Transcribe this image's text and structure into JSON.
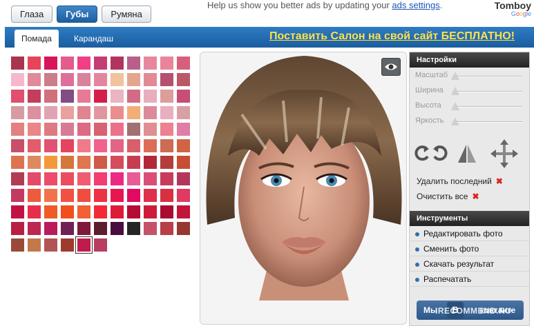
{
  "top_tabs": [
    {
      "label": "Глаза",
      "active": false
    },
    {
      "label": "Губы",
      "active": true
    },
    {
      "label": "Румяна",
      "active": false
    }
  ],
  "ads_note": {
    "text": "Help us show you better ads by updating your ",
    "link": "ads settings",
    "suffix": "."
  },
  "brand": {
    "name": "Tomboy",
    "sub_prefix": "Google"
  },
  "sub_tabs": [
    {
      "label": "Помада",
      "active": true
    },
    {
      "label": "Карандаш",
      "active": false
    }
  ],
  "promo_link": "Поставить Салон на свой сайт БЕСПЛАТНО!",
  "palette": {
    "columns": 11,
    "selected_index": 125,
    "colors": [
      "#a8354b",
      "#e9435a",
      "#d8155a",
      "#e35c8c",
      "#f03f86",
      "#c43c74",
      "#b23560",
      "#b8608a",
      "#e7879e",
      "#e9859a",
      "#d65f7e",
      "#f6b7cc",
      "#e18a9a",
      "#cc7d8a",
      "#dd6f9a",
      "#d9829c",
      "#e3869d",
      "#f0c39d",
      "#e3a58d",
      "#e28a93",
      "#b55070",
      "#ba5867",
      "#e24e6d",
      "#c23e5b",
      "#d0707d",
      "#834c83",
      "#e97a95",
      "#d3204a",
      "#e8b5c0",
      "#d26c84",
      "#e7aebd",
      "#dd9d9c",
      "#c64e77",
      "#d69ca2",
      "#dc8f9f",
      "#e0a3b3",
      "#e8a19f",
      "#e0848f",
      "#e0969f",
      "#e98d8d",
      "#f3ad76",
      "#dc8a9b",
      "#e9aec0",
      "#d9a0a4",
      "#e28180",
      "#eb8589",
      "#dc7b81",
      "#d77b94",
      "#dd6a84",
      "#d76271",
      "#eb7089",
      "#a17070",
      "#df8e92",
      "#ee818f",
      "#df7fa5",
      "#c84f69",
      "#e35c6a",
      "#e25274",
      "#e6445e",
      "#ef7b8a",
      "#f1628d",
      "#e36484",
      "#d7606b",
      "#dc6e58",
      "#cc6c55",
      "#d06445",
      "#e07250",
      "#de8a61",
      "#f3993b",
      "#d5763b",
      "#e0754e",
      "#d05a4a",
      "#d54d5c",
      "#c63d52",
      "#b3273a",
      "#b33d3c",
      "#c84e33",
      "#b13c54",
      "#e44a69",
      "#ee4c6b",
      "#ec4c5e",
      "#f05d73",
      "#f23e73",
      "#ed2a82",
      "#e95b97",
      "#dc4e7a",
      "#c73c5b",
      "#b2385b",
      "#c53a60",
      "#ec5b3e",
      "#f2734a",
      "#f25043",
      "#f04c3f",
      "#ec3343",
      "#e8164f",
      "#e20962",
      "#de2f4b",
      "#d73042",
      "#e03a63",
      "#c41145",
      "#e92e4b",
      "#f15925",
      "#f24f1c",
      "#f26035",
      "#f22a37",
      "#dd1b39",
      "#b30c35",
      "#cc1c3a",
      "#ab0b31",
      "#c2153a",
      "#b81f45",
      "#be2752",
      "#b91c5a",
      "#6d2155",
      "#801a3a",
      "#5b1d30",
      "#4a0d3f",
      "#262626",
      "#c45368",
      "#b83e48",
      "#963730",
      "#9a4a39",
      "#c3784a",
      "#b35454",
      "#9d3a2c",
      "#c01b4c",
      "#b83d60"
    ]
  },
  "photo": {
    "description_icon": "eye-icon"
  },
  "settings": {
    "header": "Настройки",
    "sliders": [
      {
        "label": "Масштаб",
        "value": 0
      },
      {
        "label": "Ширина",
        "value": 0
      },
      {
        "label": "Высота",
        "value": 0
      },
      {
        "label": "Яркость",
        "value": 0
      }
    ],
    "tool_icons": [
      "rotate-left-icon",
      "rotate-right-icon",
      "mirror-icon",
      "move-arrows-icon"
    ],
    "actions": [
      {
        "label": "Удалить последний"
      },
      {
        "label": "Очистить все"
      }
    ]
  },
  "instruments": {
    "header": "Инструменты",
    "items": [
      {
        "label": "Редактировать фото"
      },
      {
        "label": "Сменить фото"
      },
      {
        "label": "Скачать результат"
      },
      {
        "label": "Распечатать"
      }
    ]
  },
  "vk_button": {
    "left_text": "Мы",
    "badge": "В",
    "right_text": "контакте"
  },
  "watermark": "IRECOMMEND.RU"
}
